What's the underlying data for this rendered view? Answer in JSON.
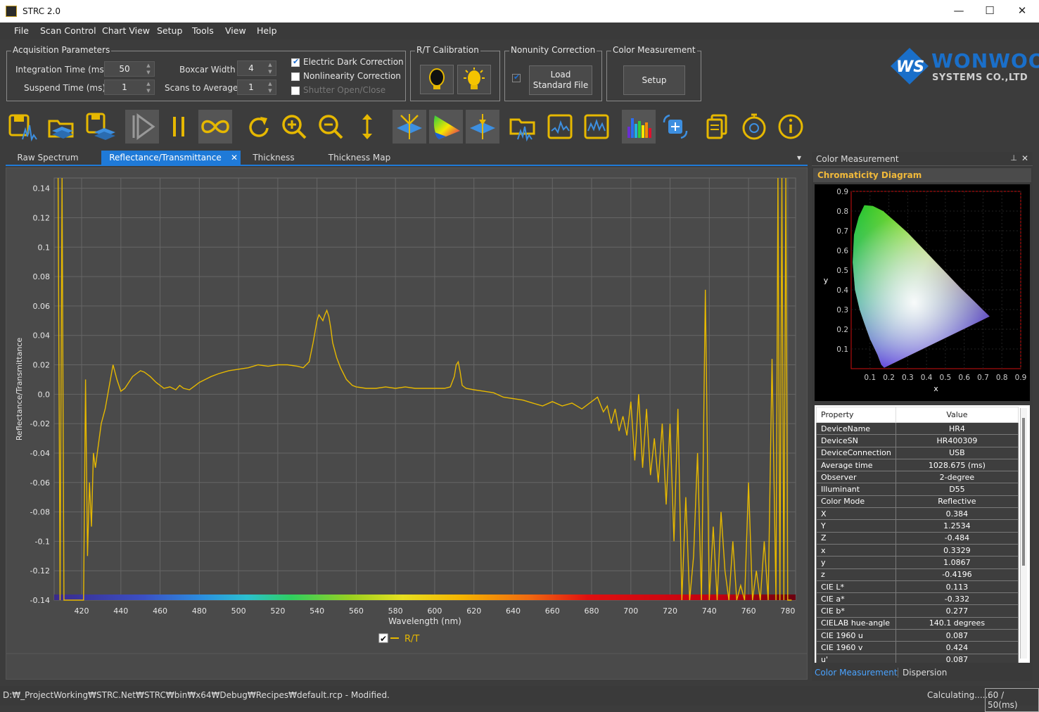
{
  "window": {
    "title": "STRC 2.0",
    "minimize": "—",
    "maximize": "☐",
    "close": "✕"
  },
  "menu": [
    "File",
    "Scan Control",
    "Chart View",
    "Setup",
    "Tools",
    "View",
    "Help"
  ],
  "acquisition": {
    "legend": "Acquisition Parameters",
    "integration_label": "Integration Time (ms)",
    "integration_value": "50",
    "suspend_label": "Suspend Time (ms)",
    "suspend_value": "1",
    "boxcar_label": "Boxcar Width",
    "boxcar_value": "4",
    "scans_label": "Scans to Average",
    "scans_value": "1",
    "electric_dark": {
      "label": "Electric Dark Correction",
      "checked": true
    },
    "nonlinearity": {
      "label": "Nonlinearity Correction",
      "checked": false
    },
    "shutter": {
      "label": "Shutter Open/Close",
      "checked": false
    }
  },
  "rt_calibration": {
    "legend": "R/T Calibration"
  },
  "nonunity": {
    "legend": "Nonunity Correction",
    "checked": true,
    "button_line1": "Load",
    "button_line2": "Standard File"
  },
  "color_measurement_group": {
    "legend": "Color Measurement",
    "button": "Setup"
  },
  "logo": {
    "mark": "WS",
    "name": "WONWOO",
    "sub": "SYSTEMS CO.,LTD"
  },
  "toolbar": [
    "save-spectrum-icon",
    "open-folder-icon",
    "save-multiple-icon",
    "play-icon",
    "pause-icon",
    "continuous-icon",
    "refresh-icon",
    "zoom-in-icon",
    "zoom-out-icon",
    "vertical-scale-icon",
    "baseline-icon",
    "color-gamut-icon",
    "peak-icon",
    "open-spectrum-icon",
    "spectrum-frame-icon",
    "spectrum-frame2-icon",
    "color-spectrum-icon",
    "sync-icon",
    "copy-icon",
    "timer-icon",
    "info-icon"
  ],
  "tabs": [
    "Raw Spectrum",
    "Reflectance/Transmittance",
    "Thickness",
    "Thickness Map"
  ],
  "tab_close": "✕",
  "tab_menu": "▾",
  "chart_data": {
    "type": "line",
    "xlabel": "Wavelength (nm)",
    "ylabel": "Reflectance/Transmittance",
    "xlim": [
      406,
      784
    ],
    "ylim": [
      -0.14,
      0.147
    ],
    "xticks": [
      420,
      440,
      460,
      480,
      500,
      520,
      540,
      560,
      580,
      600,
      620,
      640,
      660,
      680,
      700,
      720,
      740,
      760,
      780
    ],
    "yticks": [
      0.14,
      0.12,
      0.1,
      0.08,
      0.06,
      0.04,
      0.02,
      0.0,
      -0.02,
      -0.04,
      -0.06,
      -0.08,
      -0.1,
      -0.12,
      -0.14
    ],
    "ytick_labels": [
      "0.14",
      "0.12",
      "0.1",
      "0.08",
      "0.06",
      "0.04",
      "0.02",
      "0.0",
      "-0.02",
      "-0.04",
      "-0.06",
      "-0.08",
      "-0.1",
      "-0.12",
      "-0.14"
    ],
    "grid": true,
    "legend_position": "bottom-center",
    "series": [
      {
        "name": "R/T",
        "color": "#e6b800",
        "x": [
          408,
          409,
          410,
          411,
          412,
          413,
          414,
          415,
          416,
          417,
          418,
          419,
          420,
          421,
          422,
          423,
          424,
          425,
          426,
          427,
          428,
          430,
          432,
          434,
          436,
          438,
          440,
          442,
          444,
          446,
          448,
          450,
          452,
          455,
          458,
          460,
          462,
          465,
          468,
          470,
          472,
          475,
          478,
          480,
          483,
          486,
          490,
          495,
          500,
          505,
          510,
          515,
          520,
          525,
          530,
          533,
          536,
          538,
          540,
          541,
          542,
          543,
          544,
          545,
          546,
          547,
          548,
          550,
          552,
          555,
          558,
          560,
          565,
          570,
          575,
          580,
          585,
          590,
          595,
          600,
          605,
          608,
          610,
          611,
          612,
          613,
          614,
          616,
          620,
          625,
          630,
          635,
          640,
          645,
          650,
          655,
          660,
          665,
          670,
          675,
          680,
          683,
          686,
          688,
          690,
          692,
          694,
          696,
          698,
          700,
          702,
          704,
          706,
          708,
          710,
          712,
          714,
          716,
          718,
          720,
          722,
          724,
          726,
          728,
          730,
          732,
          734,
          736,
          738,
          740,
          742,
          744,
          746,
          748,
          750,
          752,
          754,
          756,
          758,
          760,
          762,
          764,
          766,
          768,
          770,
          772,
          774,
          775,
          776,
          777,
          778,
          779,
          780,
          781,
          782
        ],
        "y": [
          0.15,
          -0.14,
          0.15,
          -0.14,
          -0.14,
          -0.14,
          -0.14,
          -0.14,
          -0.14,
          -0.14,
          -0.14,
          -0.14,
          -0.14,
          -0.14,
          0.01,
          -0.11,
          -0.06,
          -0.09,
          -0.04,
          -0.05,
          -0.04,
          -0.02,
          -0.01,
          0.005,
          0.02,
          0.01,
          0.002,
          0.004,
          0.008,
          0.012,
          0.014,
          0.016,
          0.015,
          0.012,
          0.008,
          0.006,
          0.004,
          0.005,
          0.003,
          0.006,
          0.004,
          0.003,
          0.006,
          0.008,
          0.01,
          0.012,
          0.014,
          0.016,
          0.017,
          0.018,
          0.02,
          0.019,
          0.02,
          0.02,
          0.019,
          0.018,
          0.022,
          0.035,
          0.05,
          0.054,
          0.052,
          0.05,
          0.054,
          0.057,
          0.053,
          0.045,
          0.035,
          0.025,
          0.018,
          0.01,
          0.006,
          0.005,
          0.004,
          0.004,
          0.005,
          0.004,
          0.005,
          0.004,
          0.004,
          0.004,
          0.004,
          0.005,
          0.012,
          0.02,
          0.022,
          0.015,
          0.006,
          0.004,
          0.003,
          0.002,
          0.001,
          -0.002,
          -0.003,
          -0.004,
          -0.006,
          -0.008,
          -0.005,
          -0.008,
          -0.006,
          -0.01,
          -0.005,
          -0.002,
          -0.012,
          -0.008,
          -0.02,
          -0.01,
          -0.025,
          -0.015,
          -0.028,
          -0.005,
          -0.045,
          0.0,
          -0.05,
          -0.01,
          -0.055,
          -0.03,
          -0.06,
          -0.02,
          -0.075,
          -0.02,
          -0.1,
          -0.01,
          -0.14,
          -0.07,
          -0.14,
          -0.11,
          -0.04,
          -0.14,
          0.071,
          -0.14,
          -0.09,
          -0.14,
          -0.08,
          -0.12,
          -0.14,
          -0.1,
          -0.14,
          -0.13,
          -0.14,
          -0.06,
          -0.14,
          -0.12,
          -0.14,
          -0.1,
          -0.14,
          0.024,
          -0.14,
          0.15,
          -0.14,
          0.15,
          -0.14,
          0.15,
          -0.14,
          -0.14,
          -0.14
        ]
      }
    ]
  },
  "right_panel": {
    "title": "Color Measurement",
    "pin": "📌",
    "close": "✕",
    "subtitle": "Chromaticity Diagram",
    "cie": {
      "xlabel": "x",
      "ylabel": "y",
      "xticks": [
        "0.1",
        "0.2",
        "0.3",
        "0.4",
        "0.5",
        "0.6",
        "0.7",
        "0.8",
        "0.9"
      ],
      "yticks": [
        "0.9",
        "0.8",
        "0.7",
        "0.6",
        "0.5",
        "0.4",
        "0.3",
        "0.2",
        "0.1"
      ]
    },
    "table_header": {
      "property": "Property",
      "value": "Value"
    },
    "properties": [
      {
        "k": "DeviceName",
        "v": "HR4"
      },
      {
        "k": "DeviceSN",
        "v": "HR400309"
      },
      {
        "k": "DeviceConnection",
        "v": "USB"
      },
      {
        "k": "Average time",
        "v": "1028.675 (ms)"
      },
      {
        "k": "Observer",
        "v": "2-degree"
      },
      {
        "k": "Illuminant",
        "v": "D55"
      },
      {
        "k": "Color Mode",
        "v": "Reflective"
      },
      {
        "k": "X",
        "v": "0.384"
      },
      {
        "k": "Y",
        "v": "1.2534"
      },
      {
        "k": "Z",
        "v": "-0.484"
      },
      {
        "k": "x",
        "v": "0.3329"
      },
      {
        "k": "y",
        "v": "1.0867"
      },
      {
        "k": "z",
        "v": "-0.4196"
      },
      {
        "k": "CIE L*",
        "v": "0.113"
      },
      {
        "k": "CIE a*",
        "v": "-0.332"
      },
      {
        "k": "CIE b*",
        "v": "0.277"
      },
      {
        "k": "CIELAB hue-angle",
        "v": "140.1 degrees"
      },
      {
        "k": "CIE 1960 u",
        "v": "0.087"
      },
      {
        "k": "CIE 1960 v",
        "v": "0.424"
      },
      {
        "k": "u'",
        "v": "0.087"
      }
    ],
    "tabs": [
      "Color Measurement",
      "Dispersion"
    ]
  },
  "status": {
    "path": "D:₩_ProjectWorking₩STRC.Net₩STRC₩bin₩x64₩Debug₩Recipes₩default.rcp  - Modified.",
    "calc": "Calculating......",
    "rate": "60 / 50(ms)"
  },
  "colors": {
    "accent": "#1f7ad8",
    "series": "#e6b800",
    "gold": "#f1b93a",
    "logo_blue": "#1a6fc9"
  }
}
